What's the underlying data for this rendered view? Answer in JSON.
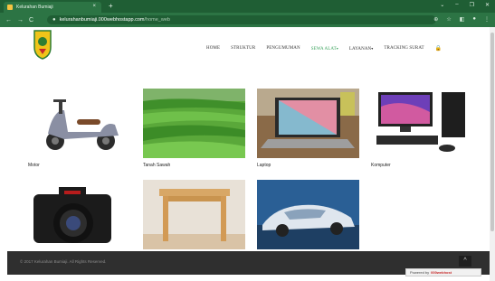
{
  "browser": {
    "tab_title": "Kelurahan Bumiaji",
    "tab_close": "×",
    "new_tab": "+",
    "window_controls": [
      "⌄",
      "–",
      "❐",
      "✕"
    ],
    "nav_buttons": [
      "←",
      "→",
      "C"
    ],
    "url_host": "kelurahanbumiaji.000webhostapp.com",
    "url_path": "/home_web",
    "icons": [
      "⊕",
      "☆",
      "◧",
      "●",
      "⋮"
    ]
  },
  "nav": {
    "items": [
      {
        "label": "HOME",
        "active": false,
        "caret": ""
      },
      {
        "label": "STRUKTUR",
        "active": false,
        "caret": ""
      },
      {
        "label": "PENGUMUMAN",
        "active": false,
        "caret": ""
      },
      {
        "label": "SEWA ALAT",
        "active": true,
        "caret": "▾"
      },
      {
        "label": "LAYANAN",
        "active": false,
        "caret": "▾"
      },
      {
        "label": "TRACKING SURAT",
        "active": false,
        "caret": ""
      }
    ],
    "cart_icon": "🔒"
  },
  "items": [
    {
      "name": "Motor",
      "image": "scooter"
    },
    {
      "name": "Tanah Sawah",
      "image": "rice-field"
    },
    {
      "name": "Laptop",
      "image": "laptop"
    },
    {
      "name": "Komputer",
      "image": "computer"
    },
    {
      "name": "",
      "image": "camera"
    },
    {
      "name": "",
      "image": "table"
    },
    {
      "name": "",
      "image": "car"
    }
  ],
  "footer": {
    "copyright": "© 2017 Kelurahan Bumiaji. All Rights Reserved.",
    "scroll_top_icon": "^",
    "badge_prefix": "Powered by",
    "badge_brand": "000webhost"
  }
}
